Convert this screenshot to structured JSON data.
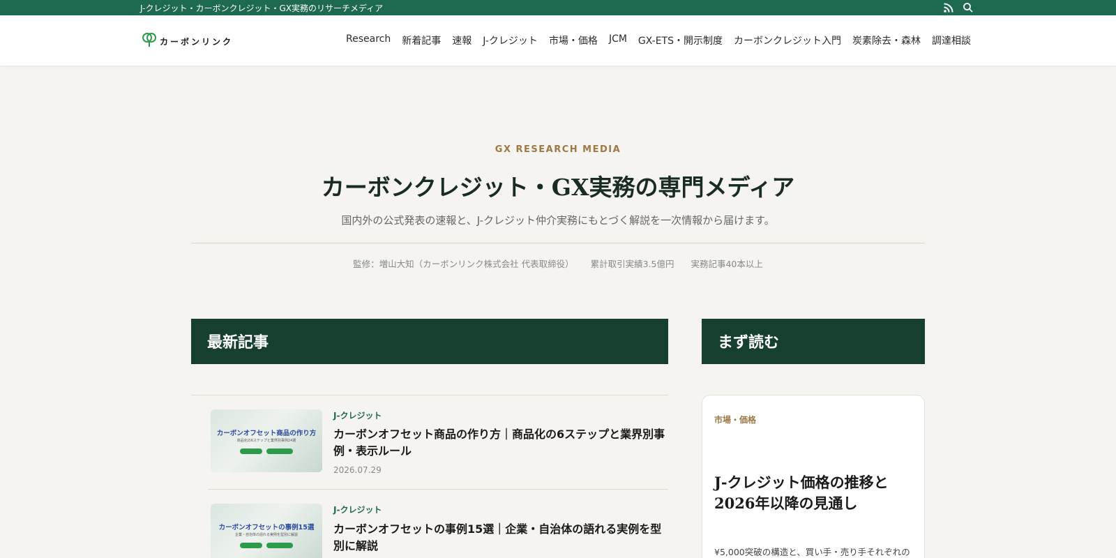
{
  "topbar": {
    "tagline": "J-クレジット・カーボンクレジット・GX実務のリサーチメディア",
    "rss_icon": "rss-icon",
    "search_icon": "search-icon"
  },
  "header": {
    "logo_text": "カーボンリンク",
    "nav": [
      "Research",
      "新着記事",
      "速報",
      "J-クレジット",
      "市場・価格",
      "JCM",
      "GX-ETS・開示制度",
      "カーボンクレジット入門",
      "炭素除去・森林",
      "調達相談"
    ]
  },
  "hero": {
    "eyebrow": "GX RESEARCH MEDIA",
    "title": "カーボンクレジット・GX実務の専門メディア",
    "description": "国内外の公式発表の速報と、J-クレジット仲介実務にもとづく解説を一次情報から届けます。",
    "meta": [
      "監修：増山大知（カーボンリンク株式会社 代表取締役）",
      "累計取引実績3.5億円",
      "実務記事40本以上"
    ]
  },
  "latest": {
    "heading": "最新記事",
    "articles": [
      {
        "category": "J-クレジット",
        "title": "カーボンオフセット商品の作り方｜商品化の6ステップと業界別事例・表示ルール",
        "date": "2026.07.29",
        "thumb_title": "カーボンオフセット商品の作り方",
        "thumb_sub": "商品化の6ステップと業界別事例24選"
      },
      {
        "category": "J-クレジット",
        "title": "カーボンオフセットの事例15選｜企業・自治体の語れる実例を型別に解説",
        "thumb_title": "カーボンオフセットの事例15選",
        "thumb_sub": "企業・自治体の語れる実例を型別に解説"
      }
    ]
  },
  "first_read": {
    "heading": "まず読む",
    "card": {
      "category": "市場・価格",
      "title": "J-クレジット価格の推移と2026年以降の見通し",
      "description": "¥5,000突破の構造と、買い手・売り手それぞれの"
    }
  },
  "colors": {
    "topbar": "#1e6a50",
    "section_bar": "#163f30",
    "accent_gold": "#9c7a48",
    "background": "#f5f4f0"
  }
}
